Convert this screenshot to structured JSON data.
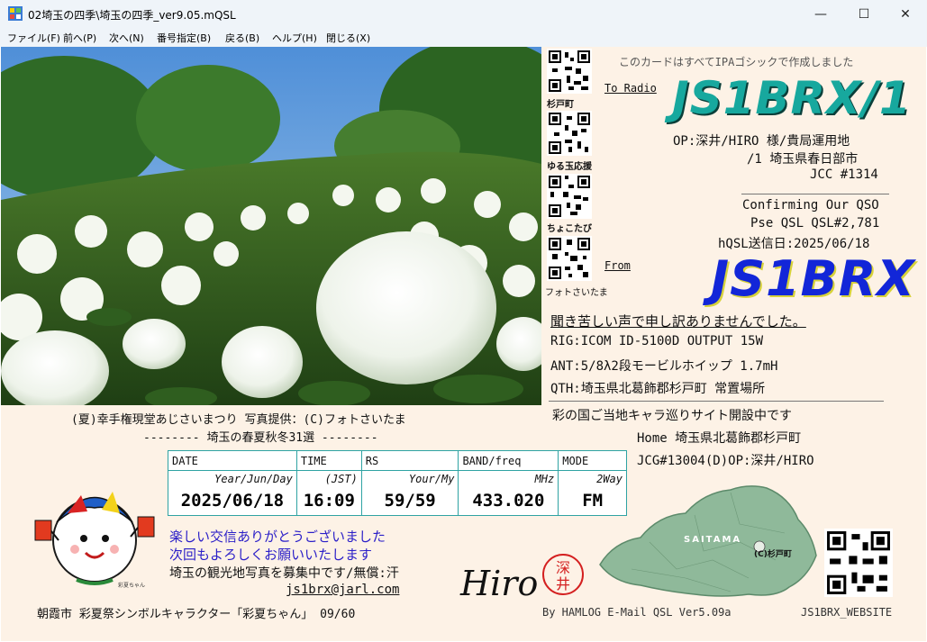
{
  "window": {
    "title": "02埼玉の四季\\埼玉の四季_ver9.05.mQSL",
    "minimize_glyph": "—",
    "maximize_glyph": "☐",
    "close_glyph": "✕"
  },
  "menu": [
    {
      "label": "ファイル(F)"
    },
    {
      "label": "前へ(P)"
    },
    {
      "label": "次へ(N)"
    },
    {
      "label": "番号指定(B)"
    },
    {
      "label": "戻る(B)"
    },
    {
      "label": "ヘルプ(H)"
    },
    {
      "label": "閉じる(X)"
    }
  ],
  "card": {
    "font_note": "このカードはすべてIPAゴシックで作成しました",
    "to_label": "To Radio",
    "to_call": "JS1BRX/1",
    "op_line": "OP:深井/HIRO 様/貴局運用地",
    "area_line": "/1 埼玉県春日部市",
    "jcc_line": "JCC #1314",
    "confirm_line": "Confirming Our QSO",
    "pse_line": "Pse QSL QSL#2,781",
    "hqsl_line": "hQSL送信日:2025/06/18",
    "from_label": "From",
    "from_call": "JS1BRX",
    "apology": "聞き苦しい声で申し訳ありませんでした。",
    "rig": "RIG:ICOM ID-5100D OUTPUT 15W",
    "ant": "ANT:5/8λ2段モービルホイップ 1.7mH",
    "qth": "QTH:埼玉県北葛飾郡杉戸町 常置場所",
    "site_notice": "彩の国ご当地キャラ巡りサイト開設中です",
    "home": "Home 埼玉県北葛飾郡杉戸町",
    "jcg": "JCG#13004(D)OP:深井/HIRO",
    "photo_caption": "(夏)幸手権現堂あじさいまつり 写真提供：(C)フォトさいたま",
    "series_title": "-------- 埼玉の春夏秋冬31選 --------",
    "msg1": "楽しい交信ありがとうございました",
    "msg2": "次回もよろしくお願いいたします",
    "msg3": "埼玉の観光地写真を募集中です/無償:汗",
    "email": "js1brx@jarl.com",
    "mascot_caption": "朝霞市 彩夏祭シンボルキャラクター「彩夏ちゃん」 09/60",
    "footer": "By HAMLOG E-Mail QSL Ver5.09a",
    "website": "JS1BRX_WEBSITE",
    "signature": "Hiro",
    "stamp_top": "深",
    "stamp_bottom": "井",
    "map_label": "SAITAMA",
    "map_town": "(C)杉戸町",
    "mascot_tag": "彩夏ちゃん"
  },
  "qr_codes": [
    {
      "label": "杉戸町"
    },
    {
      "label": "ゆる玉応援"
    },
    {
      "label": "ちょこたび"
    },
    {
      "label": "フォトさいたま"
    }
  ],
  "qso_table": {
    "headers": [
      "DATE",
      "TIME",
      "RS",
      "BAND/freq",
      "MODE"
    ],
    "sub": [
      "Year/Jun/Day",
      "(JST)",
      "Your/My",
      "MHz",
      "2Way"
    ],
    "values": [
      "2025/06/18",
      "16:09",
      "59/59",
      "433.020",
      "FM"
    ]
  },
  "colors": {
    "callsign": "#17a89e",
    "from_call": "#1226d8",
    "table_border": "#2fa3a3",
    "message_blue": "#2b1fc8",
    "card_bg": "#fdf2e6",
    "stamp_red": "#d42020"
  }
}
